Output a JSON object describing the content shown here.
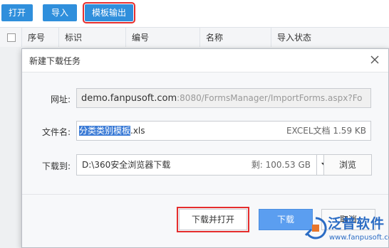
{
  "toolbar": {
    "open_label": "打开",
    "import_label": "导入",
    "export_template_label": "模板输出"
  },
  "grid": {
    "columns": [
      "序号",
      "标识",
      "编号",
      "名称",
      "导入状态"
    ]
  },
  "dialog": {
    "title": "新建下载任务",
    "url_label": "网址:",
    "url_host": "demo.fanpusoft.com",
    "url_rest": ":8080/FormsManager/ImportForms.aspx?Fo",
    "filename_label": "文件名:",
    "filename_selected": "分类类别模板",
    "filename_ext": ".xls",
    "file_meta": "EXCEL文档 1.59 KB",
    "saveto_label": "下载到:",
    "save_path": "D:\\360安全浏览器下载",
    "free_space": "剩: 100.53 GB",
    "browse_label": "浏览",
    "download_open_label": "下载并打开",
    "download_label": "下载",
    "cancel_label": "取消"
  },
  "watermark": {
    "brand": "泛普软件",
    "site": "www.fanpusoft.com"
  },
  "colors": {
    "toolbar_button": "#2f8fdc",
    "highlight": "#e52d2d",
    "primary": "#5b9ef0",
    "selection": "#3b7bd6",
    "brand": "#2b6cc4"
  }
}
